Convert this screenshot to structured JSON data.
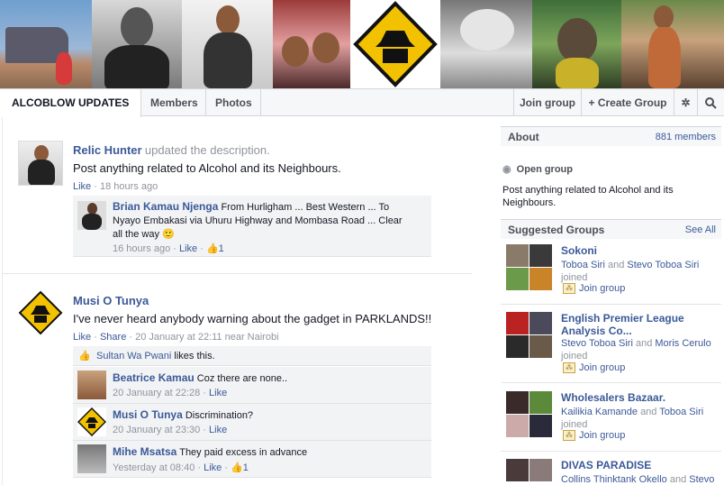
{
  "banner": {
    "count": 8
  },
  "tabs": {
    "group_name": "ALCOBLOW UPDATES",
    "members": "Members",
    "photos": "Photos",
    "join_group": "Join group",
    "create_group": "Create Group"
  },
  "icons": {
    "create": "plus-icon",
    "settings": "gear-icon",
    "search": "search-icon",
    "like": "thumbs-up-icon",
    "globe": "globe-icon",
    "join": "group-join-icon"
  },
  "colors": {
    "link": "#3b5998",
    "meta": "#90949c",
    "comment_bg": "#f2f3f5",
    "bar_bg": "#f6f7f9"
  },
  "posts": [
    {
      "author": "Relic Hunter",
      "action": "updated the description.",
      "text": "Post anything related to Alcohol and its Neighbours.",
      "like": "Like",
      "time": "18 hours ago",
      "comments": [
        {
          "author": "Brian Kamau Njenga",
          "text": "From Hurligham ... Best Western ... To Nyayo Embakasi via Uhuru Highway and Mombasa Road ... Clear all the way",
          "emoji": "🙂",
          "time": "16 hours ago",
          "like": "Like",
          "likes": "1"
        }
      ]
    },
    {
      "author": "Musi O Tunya",
      "text": "I've never heard anybody warning about the gadget in PARKLANDS!!",
      "like": "Like",
      "share": "Share",
      "time": "20 January at 22:11 near Nairobi",
      "likes_line": {
        "name": "Sultan Wa Pwani",
        "text": "likes this."
      },
      "comments": [
        {
          "author": "Beatrice Kamau",
          "text": "Coz there are none..",
          "time": "20 January at 22:28",
          "like": "Like"
        },
        {
          "author": "Musi O Tunya",
          "text": "Discrimination?",
          "time": "20 January at 23:30",
          "like": "Like"
        },
        {
          "author": "Mihe Msatsa",
          "text": "They paid excess in advance",
          "time": "Yesterday at 08:40",
          "like": "Like",
          "likes": "1"
        }
      ]
    }
  ],
  "about": {
    "title": "About",
    "members": "881 members",
    "type": "Open group",
    "description": "Post anything related to Alcohol and its Neighbours."
  },
  "suggested": {
    "title": "Suggested Groups",
    "see_all": "See All",
    "groups": [
      {
        "name": "Sokoni",
        "m1": "Toboa Siri",
        "and": "and",
        "m2": "Stevo Toboa Siri",
        "joined": "joined",
        "join": "Join group"
      },
      {
        "name": "English Premier League Analysis Co...",
        "m1": "Stevo Toboa Siri",
        "and": "and",
        "m2": "Moris Cerulo",
        "joined": "joined",
        "join": "Join group"
      },
      {
        "name": "Wholesalers Bazaar.",
        "m1": "Kailikia Kamande",
        "and": "and",
        "m2": "Toboa Siri",
        "joined": "joined",
        "join": "Join group"
      },
      {
        "name": "DIVAS PARADISE",
        "m1": "Collins Thinktank Okello",
        "and": "and",
        "m2": "Stevo",
        "joined": "",
        "join": ""
      }
    ]
  }
}
